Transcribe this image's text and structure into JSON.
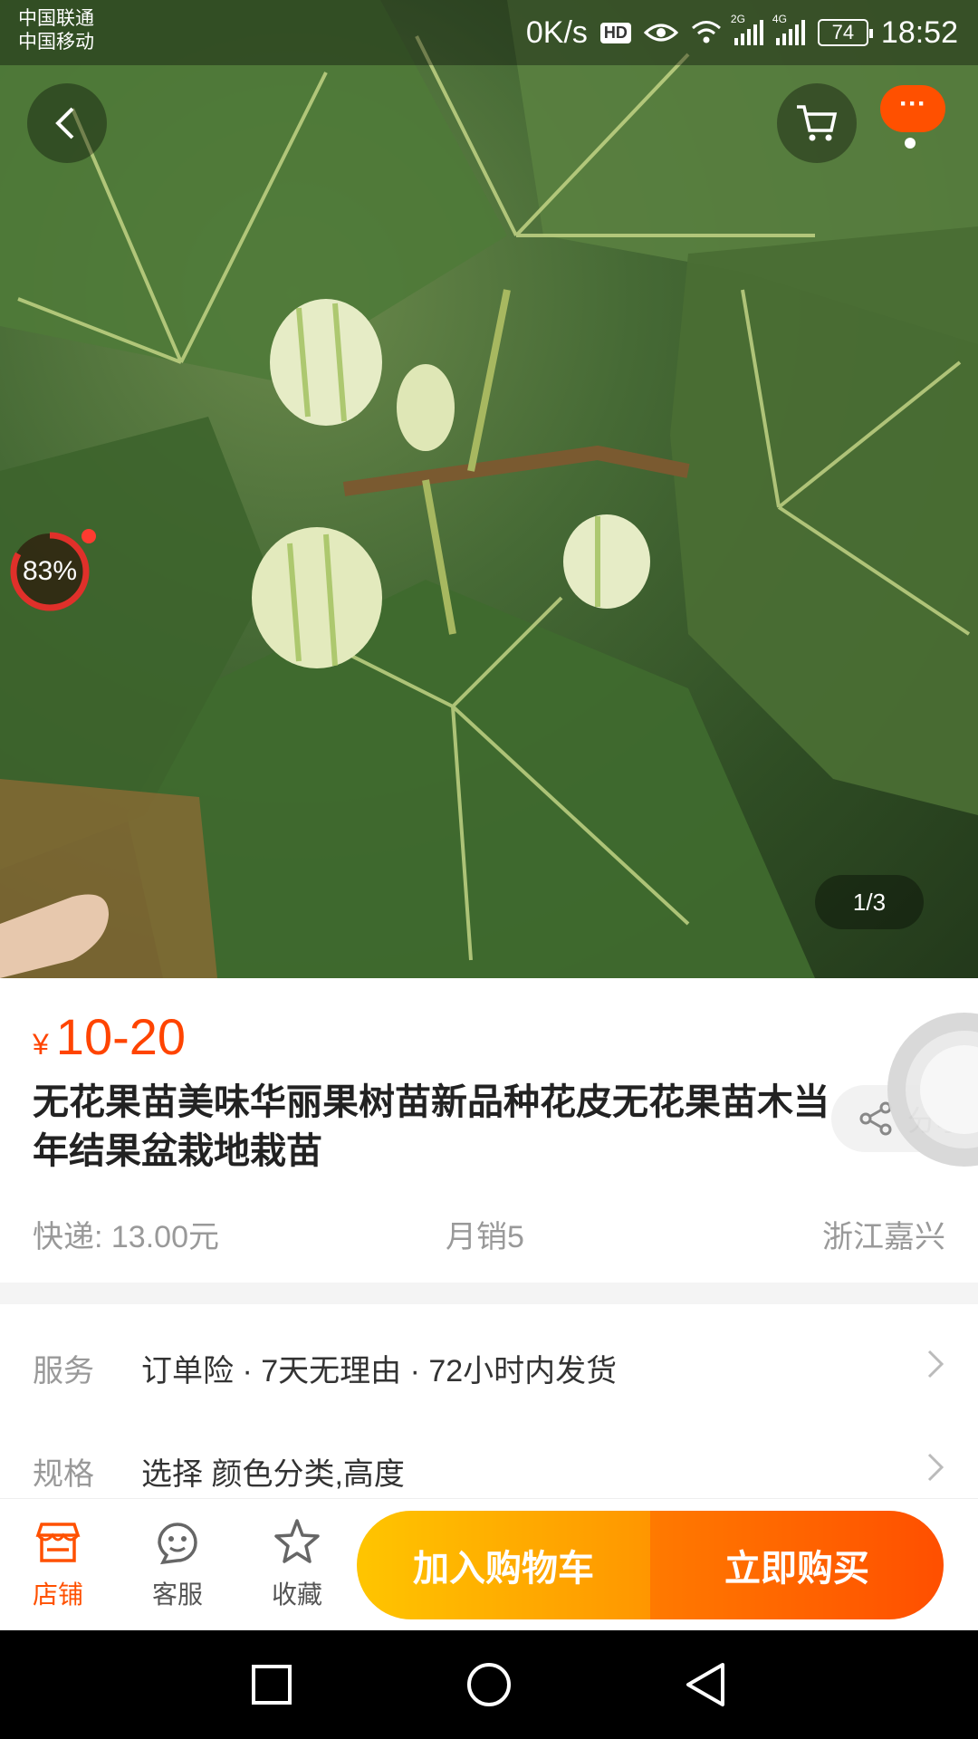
{
  "status_bar": {
    "carrier_1": "中国联通",
    "carrier_2": "中国移动",
    "network_speed": "0K/s",
    "hd_badge": "HD",
    "signal_1_label": "2G",
    "signal_2_label": "4G",
    "battery_level": "74",
    "time": "18:52"
  },
  "header": {
    "back_icon": "chevron-left-icon",
    "cart_icon": "shopping-cart-icon",
    "more_label": "···"
  },
  "hero": {
    "image_description_icon": "fig-tree-photo",
    "progress_percent": "83%",
    "pager": "1/3"
  },
  "product": {
    "currency": "¥",
    "price": "10-20",
    "title": "无花果苗美味华丽果树苗新品种花皮无花果苗木当年结果盆栽地栽苗",
    "share_label": "分享",
    "shipping": "快递: 13.00元",
    "monthly_sales": "月销5",
    "location": "浙江嘉兴"
  },
  "rows": [
    {
      "label": "服务",
      "value": "订单险 · 7天无理由 · 72小时内发货"
    },
    {
      "label": "规格",
      "value": "选择 颜色分类,高度"
    }
  ],
  "actionbar": {
    "store_label": "店铺",
    "service_label": "客服",
    "favorite_label": "收藏",
    "add_to_cart": "加入购物车",
    "buy_now": "立即购买"
  },
  "colors": {
    "accent": "#ff5000",
    "price": "#ff4400",
    "cart_gradient": [
      "#ffc500",
      "#ff9600"
    ],
    "buy_gradient": [
      "#ff7a00",
      "#ff4f00"
    ]
  }
}
